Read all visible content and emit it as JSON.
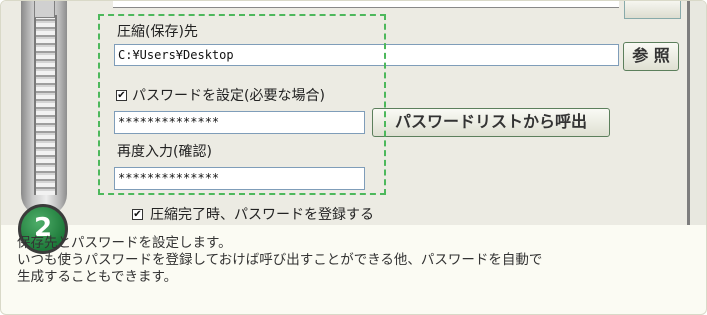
{
  "screen": {
    "dest_label": "圧縮(保存)先",
    "dest_path": "C:¥Users¥Desktop",
    "browse_label": "参 照",
    "password_checkbox_label": "パスワードを設定(必要な場合)",
    "password_checked": true,
    "password_value": "**************",
    "password_list_button": "パスワードリストから呼出",
    "reenter_label": "再度入力(確認)",
    "reenter_value": "**************",
    "register_checkbox_label": "圧縮完了時、パスワードを登録する",
    "register_checked": true,
    "step_number": "2"
  },
  "description": {
    "line1": "保存先とパスワードを設定します。",
    "line2": "いつも使うパスワードを登録しておけば呼び出すことができる他、パスワードを自動で",
    "line3": "生成することもできます。"
  },
  "colors": {
    "focus_dashed": "#4db85c",
    "badge_green": "#1e7a3a",
    "caption_bg": "#fbfbf3"
  },
  "icons": {
    "check": "✔"
  }
}
